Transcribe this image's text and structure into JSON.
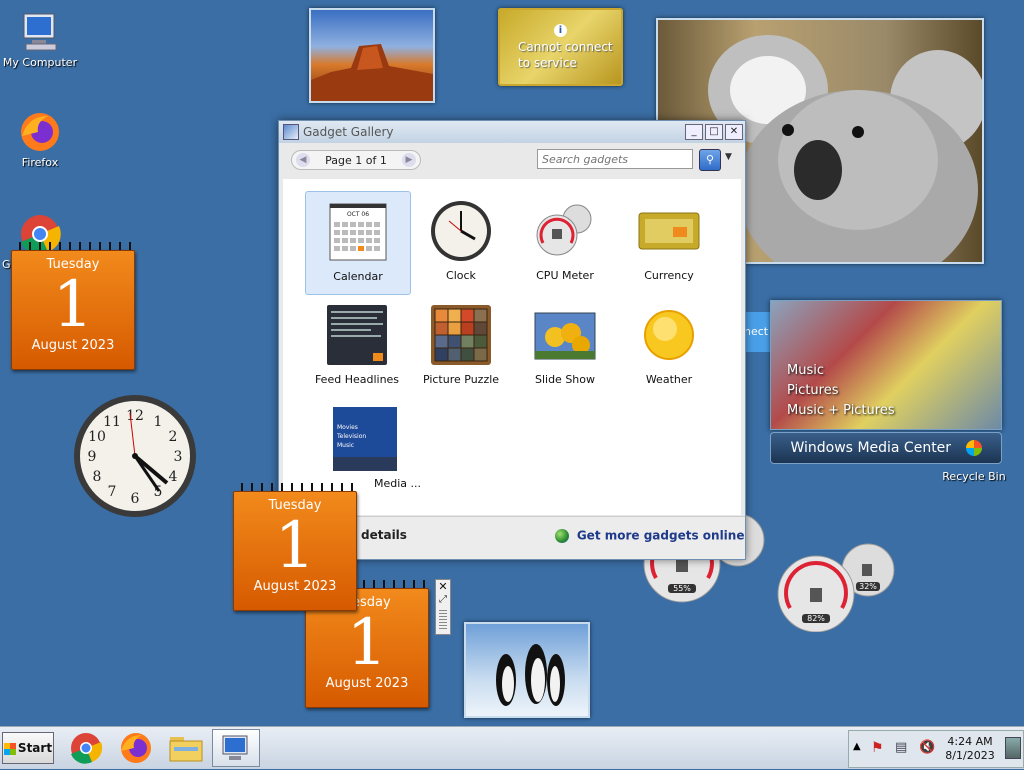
{
  "desktop": {
    "icons": [
      {
        "label": "My Computer"
      },
      {
        "label": "Firefox"
      },
      {
        "label": "Go"
      },
      {
        "label": "Recycle Bin"
      }
    ]
  },
  "currency_gadget": {
    "line1": "Cannot connect",
    "line2": "to service"
  },
  "calendars": [
    {
      "day_of_week": "Tuesday",
      "day": "1",
      "month_year": "August 2023"
    },
    {
      "day_of_week": "Tuesday",
      "day": "1",
      "month_year": "August 2023"
    },
    {
      "day_of_week": "esday",
      "day": "1",
      "month_year": "August 2023"
    }
  ],
  "cpu_meters": [
    {
      "cpu": "55%"
    },
    {
      "cpu": "82%",
      "mem": "32%"
    }
  ],
  "media_center": {
    "menu": [
      "Music",
      "Pictures",
      "Music + Pictures"
    ],
    "brand_windows": "Windows",
    "brand_mc": "Media Center",
    "peek_text": "nect"
  },
  "gallery": {
    "title": "Gadget Gallery",
    "page_label": "Page 1 of 1",
    "search_placeholder": "Search gadgets",
    "gadgets": [
      {
        "label": "Calendar"
      },
      {
        "label": "Clock"
      },
      {
        "label": "CPU Meter"
      },
      {
        "label": "Currency"
      },
      {
        "label": "Feed Headlines"
      },
      {
        "label": "Picture Puzzle"
      },
      {
        "label": "Slide Show"
      },
      {
        "label": "Weather"
      },
      {
        "label": "Media ..."
      }
    ],
    "mini_calendar_month": "OCT 06",
    "wmc_thumb_lines": [
      "Movies",
      "Television",
      "Music"
    ],
    "show_details": "details",
    "get_more": "Get more gadgets online"
  },
  "taskbar": {
    "start_label": "Start",
    "time": "4:24 AM",
    "date": "8/1/2023"
  }
}
